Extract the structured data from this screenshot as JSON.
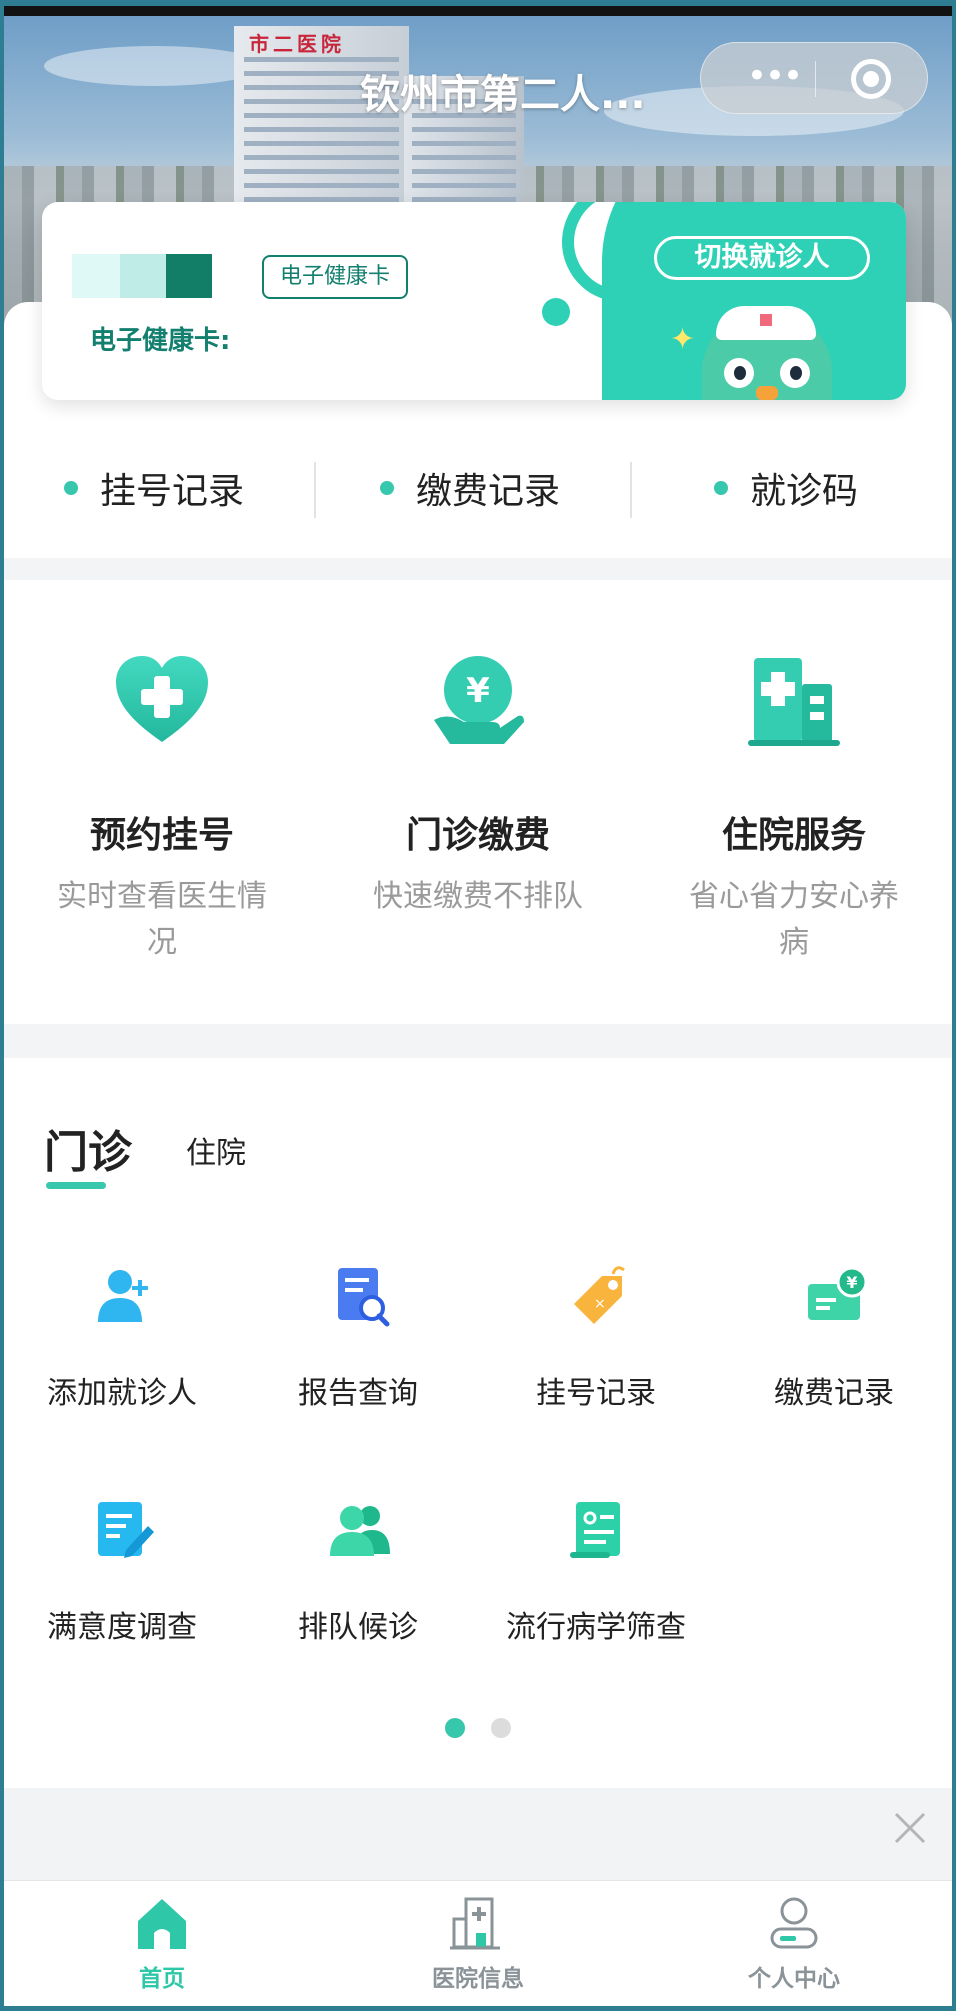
{
  "nav": {
    "title": "钦州市第二人...",
    "more_icon": "more-dots-icon",
    "close_icon": "record-target-icon"
  },
  "hero": {
    "building_sign": "市二医院"
  },
  "card": {
    "tag": "电子健康卡",
    "label": "电子健康卡:",
    "switch_label": "切换就诊人"
  },
  "quick_links": [
    {
      "label": "挂号记录"
    },
    {
      "label": "缴费记录"
    },
    {
      "label": "就诊码"
    }
  ],
  "services": [
    {
      "title": "预约挂号",
      "desc": "实时查看医生情况",
      "icon": "heart-plus-icon"
    },
    {
      "title": "门诊缴费",
      "desc": "快速缴费不排队",
      "icon": "yuan-hand-icon"
    },
    {
      "title": "住院服务",
      "desc": "省心省力安心养病",
      "icon": "hospital-building-icon"
    }
  ],
  "tabs": {
    "active": "门诊",
    "inactive": "住院"
  },
  "grid": [
    {
      "label": "添加就诊人",
      "icon": "add-person-icon"
    },
    {
      "label": "报告查询",
      "icon": "report-search-icon"
    },
    {
      "label": "挂号记录",
      "icon": "tag-icon"
    },
    {
      "label": "缴费记录",
      "icon": "payment-card-icon"
    },
    {
      "label": "满意度调查",
      "icon": "survey-icon"
    },
    {
      "label": "排队候诊",
      "icon": "queue-people-icon"
    },
    {
      "label": "流行病学筛查",
      "icon": "screening-doc-icon"
    }
  ],
  "pager": {
    "active_page": 1,
    "pages": 2
  },
  "tabbar": [
    {
      "label": "首页",
      "icon": "home-icon",
      "active": true
    },
    {
      "label": "医院信息",
      "icon": "hospital-icon",
      "active": false
    },
    {
      "label": "个人中心",
      "icon": "person-icon",
      "active": false
    }
  ],
  "colors": {
    "accent": "#36c7ad",
    "card_text": "#137f6e",
    "tab_active": "#2ec8a8",
    "tab_inactive": "#8a9398"
  }
}
